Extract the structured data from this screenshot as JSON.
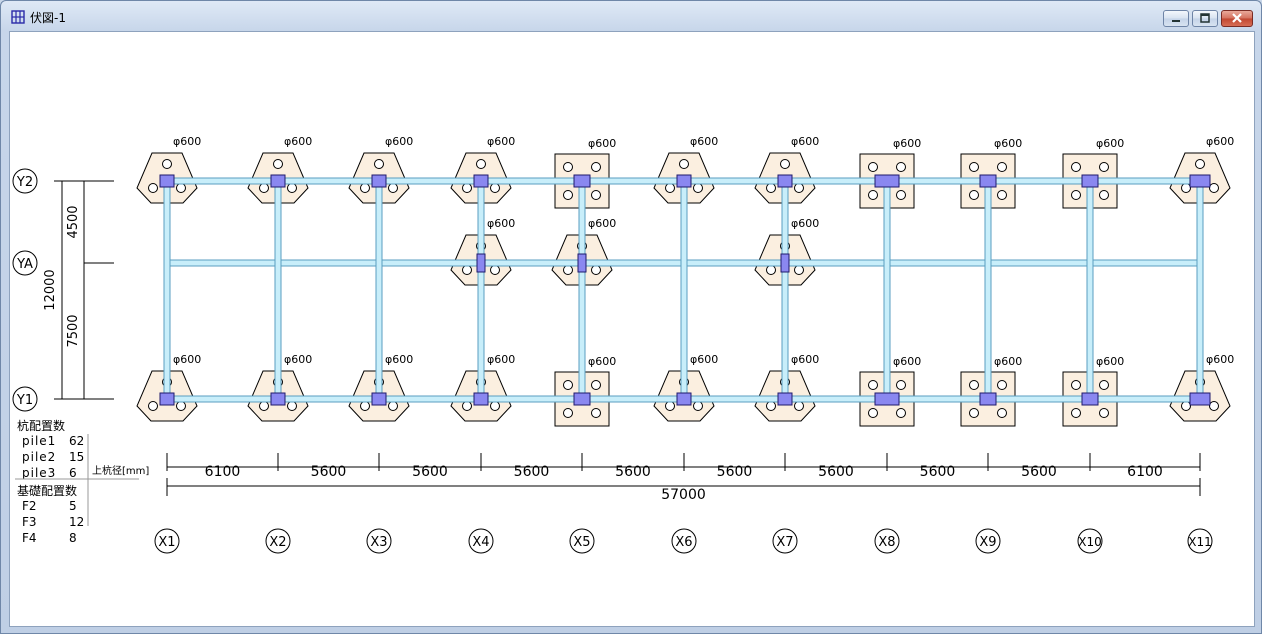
{
  "window": {
    "title": "伏図-1",
    "buttons": {
      "minimize": "minimize",
      "maximize": "maximize",
      "close": "close"
    }
  },
  "plan": {
    "grid_x": [
      "X1",
      "X2",
      "X3",
      "X4",
      "X5",
      "X6",
      "X7",
      "X8",
      "X9",
      "X10",
      "X11"
    ],
    "grid_y": [
      "Y2",
      "YA",
      "Y1"
    ],
    "spans_x": [
      "6100",
      "5600",
      "5600",
      "5600",
      "5600",
      "5600",
      "5600",
      "5600",
      "5600",
      "6100"
    ],
    "total_x": "57000",
    "spans_y": [
      "4500",
      "7500"
    ],
    "total_y": "12000",
    "pile_label": "φ600",
    "top_row_footing_types": [
      "F3",
      "F3",
      "F3",
      "F3",
      "F2",
      "F3",
      "F3",
      "F4",
      "F2",
      "F2",
      "F3"
    ],
    "middle_row_footing_types": [
      "none",
      "none",
      "none",
      "F3",
      "F3",
      "none",
      "F3",
      "none",
      "none",
      "none",
      "none"
    ],
    "bottom_row_footing_types": [
      "F3",
      "F3",
      "F3",
      "F3",
      "F2",
      "F3",
      "F3",
      "F4",
      "F2",
      "F2",
      "F3"
    ]
  },
  "summary": {
    "pile_heading": "杭配置数",
    "pile_rows": [
      {
        "label": "pile1",
        "value": "62"
      },
      {
        "label": "pile2",
        "value": "15"
      },
      {
        "label": "pile3",
        "value": "6"
      }
    ],
    "diameter_label": "上杭径[mm]",
    "footing_heading": "基礎配置数",
    "footing_rows": [
      {
        "label": "F2",
        "value": "5"
      },
      {
        "label": "F3",
        "value": "12"
      },
      {
        "label": "F4",
        "value": "8"
      }
    ]
  },
  "colors": {
    "footing_fill": "#fbefe0",
    "beam_fill": "#c8eefa",
    "beam_stroke": "#5a9ec0",
    "column_fill": "#8a87f0",
    "line": "#000000"
  }
}
